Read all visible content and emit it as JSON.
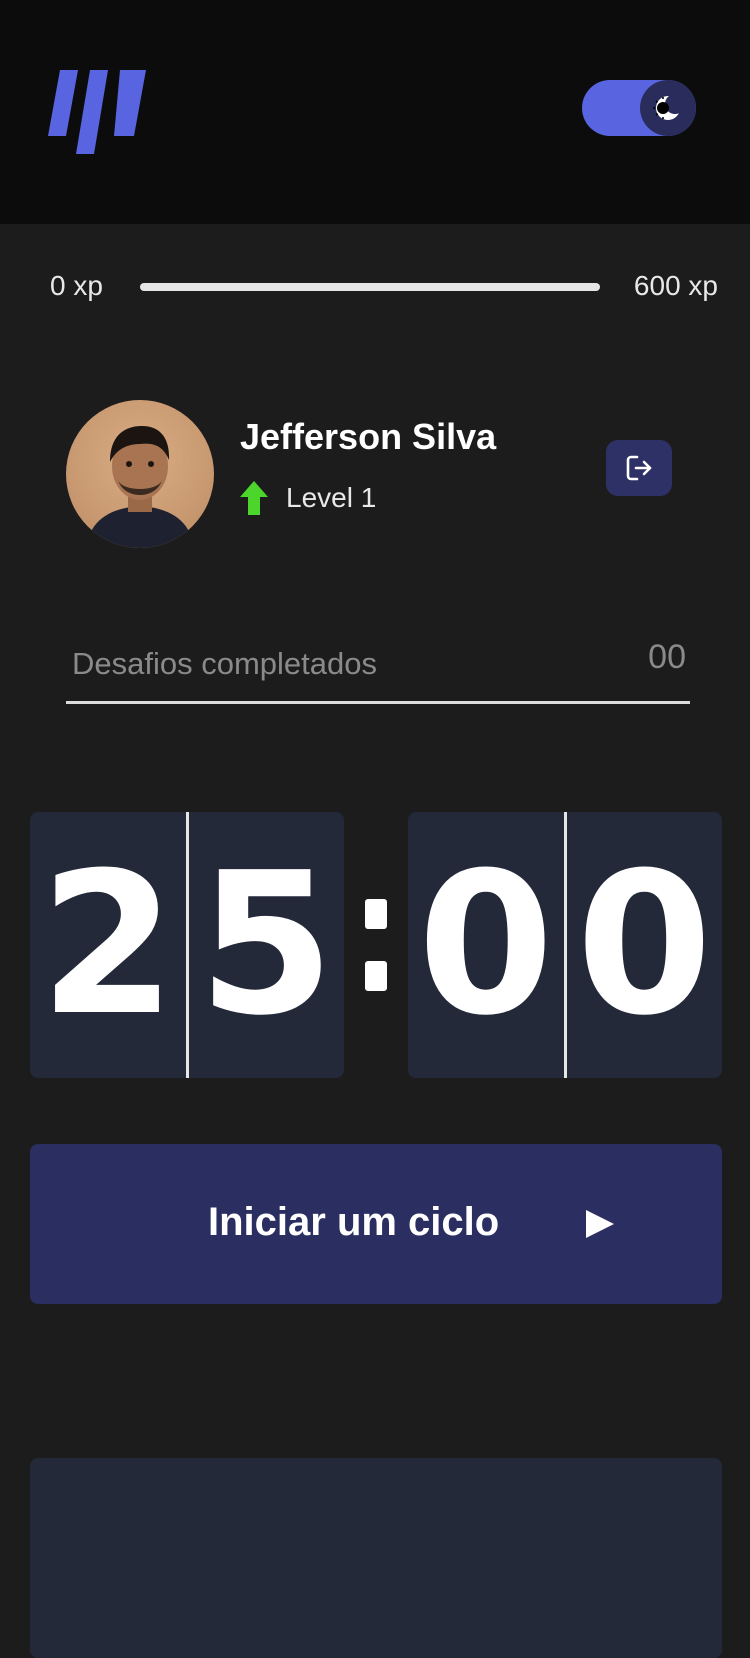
{
  "header": {
    "logo_icon": "moveit-logo-icon",
    "theme_toggle": {
      "state": "dark",
      "icon": "moon-sun-icon"
    }
  },
  "xp": {
    "min_label": "0 xp",
    "max_label": "600 xp",
    "progress_fraction": 0
  },
  "profile": {
    "name": "Jefferson Silva",
    "level_label": "Level 1",
    "level_icon": "level-up-arrow-icon",
    "logout_icon": "logout-icon"
  },
  "challenges": {
    "label": "Desafios completados",
    "count": "00"
  },
  "countdown": {
    "minute_left": "2",
    "minute_right": "5",
    "second_left": "0",
    "second_right": "0"
  },
  "actions": {
    "start_label": "Iniciar um ciclo",
    "start_icon": "play-icon"
  },
  "colors": {
    "accent": "#5965e0",
    "level_green": "#4cd62b",
    "background": "#1c1c1c",
    "header_bg": "#0c0c0d",
    "card_bg": "#232939",
    "button_bg": "#2b2e60"
  }
}
